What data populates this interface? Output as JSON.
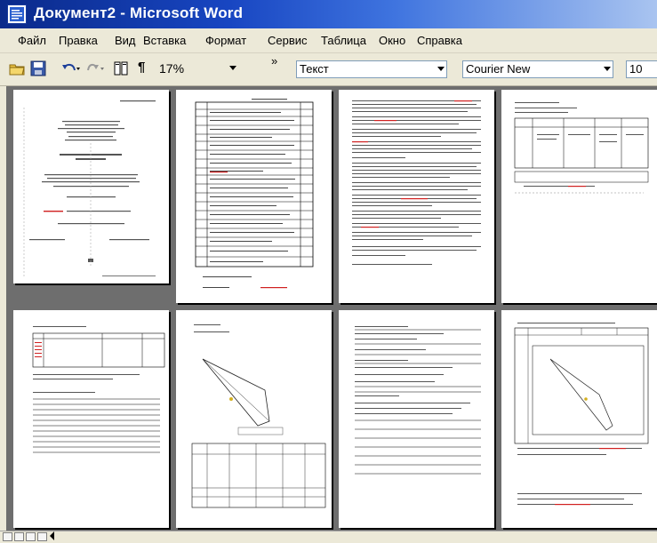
{
  "window": {
    "title": "Документ2 - Microsoft Word"
  },
  "menu": [
    "Файл",
    "Правка",
    "Вид",
    "Вставка",
    "Формат",
    "Сервис",
    "Таблица",
    "Окно",
    "Справка"
  ],
  "toolbar": {
    "zoom": "17%",
    "style": "Текст",
    "font": "Courier New",
    "size": "10",
    "overflow_chevron": "»"
  },
  "pages_shown": 8
}
